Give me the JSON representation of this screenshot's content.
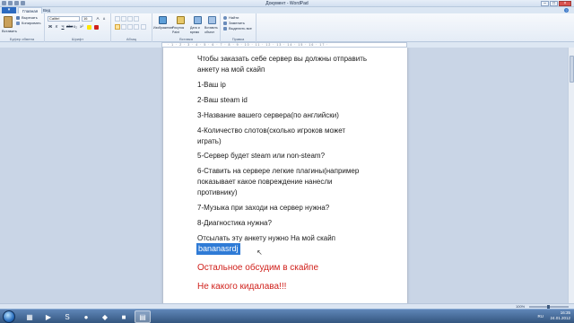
{
  "window": {
    "title": "Документ - WordPad"
  },
  "tabs": [
    {
      "label": "Главная"
    },
    {
      "label": "Вид"
    }
  ],
  "ribbon": {
    "clipboard": {
      "paste": "Вставить",
      "cut": "Вырезать",
      "copy": "Копировать",
      "group": "Буфер обмена"
    },
    "font": {
      "family": "Calibri",
      "size": "16",
      "group": "Шрифт"
    },
    "paragraph": {
      "group": "Абзац"
    },
    "insert": {
      "picture": "Изображение",
      "paint": "Рисунок Paint",
      "datetime": "Дата и время",
      "object": "Вставить объект",
      "group": "Вставка"
    },
    "editing": {
      "find": "Найти",
      "replace": "Заменить",
      "select_all": "Выделить все",
      "group": "Правка"
    }
  },
  "ruler": {
    "marks": "· 1 · 2 · 3 · 4 · 5 · 6 · 7 · 8 · 9 · 10 · 11 · 12 · 13 · 14 · 15 · 16 · 17 ·"
  },
  "document": {
    "lines": [
      "Чтобы заказать себе сервер вы должны отправить",
      "анкету на мой скайп",
      "1-Ваш ip",
      "2-Ваш  steam id",
      "3-Название вашего сервера(по английски)",
      "4-Количество слотов(сколько игроков может",
      "играть)",
      "5-Сервер будет steam или non-steam?",
      "6-Ставить на сервере легкие плагины(например",
      "показывает какое повреждение нанесли",
      "противнику)",
      "7-Музыка при заходи на сервер нужна?",
      "8-Диагностика нужна?",
      "Отсылать эту анкету  нужно На мой скайп"
    ],
    "selected": "bananasrdj",
    "red_lines": [
      "Остальное обсудим в скайпе",
      "Не какого кидалава!!!"
    ]
  },
  "status": {
    "zoom": "100%"
  },
  "tray": {
    "lang": "RU",
    "time": "16:35",
    "date": "24.01.2012"
  },
  "colors": {
    "selection": "#2f7bd6",
    "red_text": "#d0211c",
    "file_button": "#2d6bc0"
  }
}
